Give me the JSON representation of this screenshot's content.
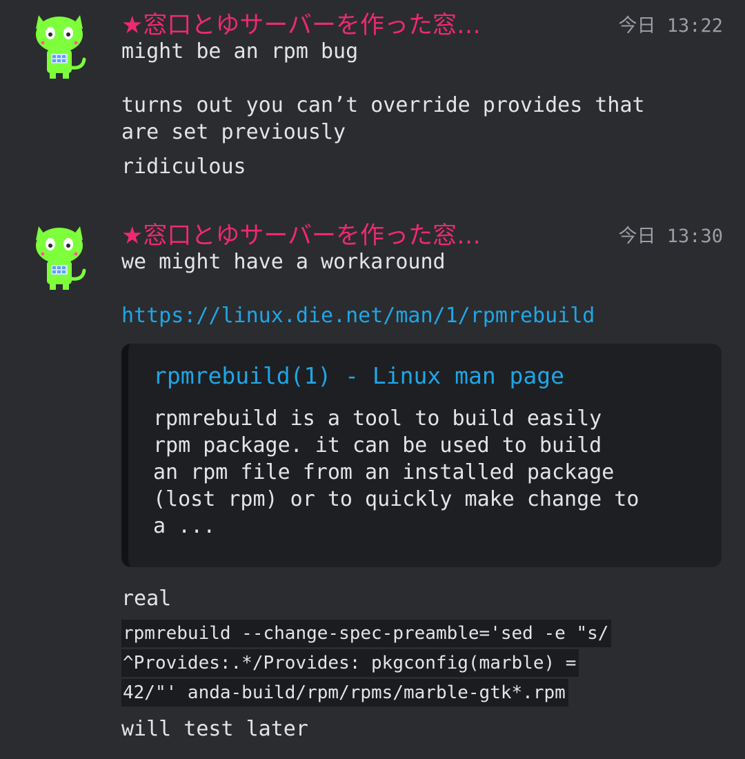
{
  "messages": [
    {
      "username": "★窓口とゆサーバーを作った窓…",
      "timestamp": "今日 13:22",
      "avatar_icon": "green-cat-avatar-icon",
      "lines": [
        "might be an rpm bug",
        "turns out you can’t override provides that",
        "are set previously",
        "ridiculous"
      ]
    },
    {
      "username": "★窓口とゆサーバーを作った窓…",
      "timestamp": "今日 13:30",
      "avatar_icon": "green-cat-avatar-icon",
      "text": "we might have a workaround",
      "link": "https://linux.die.net/man/1/rpmrebuild",
      "embed": {
        "title": "rpmrebuild(1) - Linux man page",
        "description_lines": [
          "rpmrebuild is a tool to build easily",
          "rpm package. it can be used to build",
          "an rpm file from an installed package",
          "(lost rpm) or to quickly make change to",
          "a ..."
        ]
      },
      "after_text": "real",
      "code_lines": [
        "rpmrebuild --change-spec-preamble='sed -e \"s/",
        "^Provides:.*/Provides: pkgconfig(marble) =",
        "42/\"' anda-build/rpm/rpms/marble-gtk*.rpm"
      ],
      "final_text": "will test later"
    }
  ],
  "colors": {
    "background": "#2b2c30",
    "username": "#ee2a6e",
    "link": "#1ea6e8",
    "text": "#e3e4e8",
    "timestamp": "#9c9ea6",
    "embed_background": "#1e1f22",
    "code_background": "#1b1c1f",
    "avatar_green": "#7dff3c"
  }
}
